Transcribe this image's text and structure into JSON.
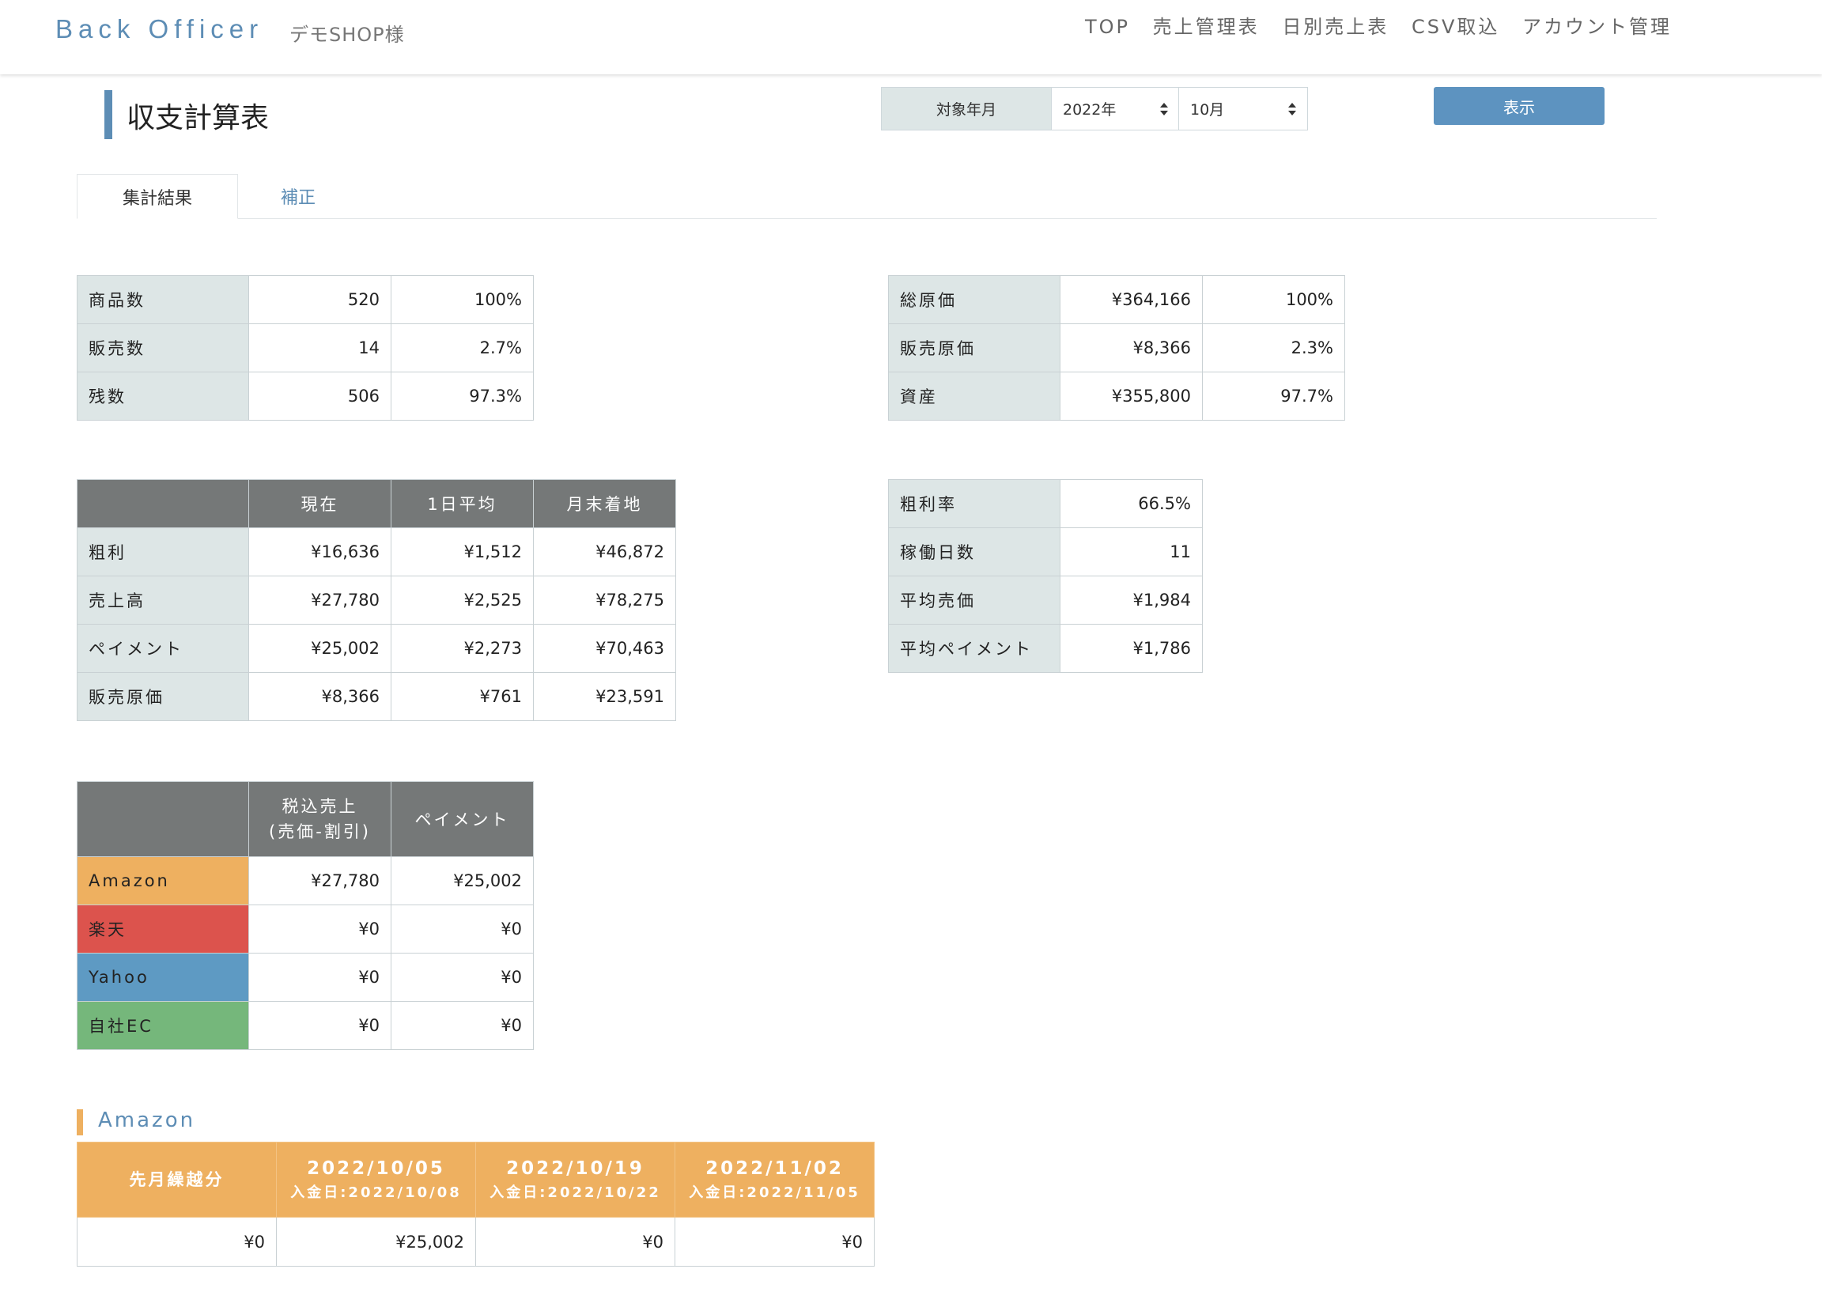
{
  "header": {
    "brand": "Back Officer",
    "shop": "デモSHOP様",
    "nav": [
      "TOP",
      "売上管理表",
      "日別売上表",
      "CSV取込",
      "アカウント管理"
    ]
  },
  "page": {
    "title": "収支計算表",
    "filter_label": "対象年月",
    "year": "2022年",
    "month": "10月",
    "show_button": "表示"
  },
  "tabs": {
    "active": "集計結果",
    "inactive": "補正"
  },
  "inventory": {
    "rows": [
      {
        "label": "商品数",
        "value": "520",
        "pct": "100%"
      },
      {
        "label": "販売数",
        "value": "14",
        "pct": "2.7%"
      },
      {
        "label": "残数",
        "value": "506",
        "pct": "97.3%"
      }
    ]
  },
  "cost": {
    "rows": [
      {
        "label": "総原価",
        "value": "¥364,166",
        "pct": "100%"
      },
      {
        "label": "販売原価",
        "value": "¥8,366",
        "pct": "2.3%"
      },
      {
        "label": "資産",
        "value": "¥355,800",
        "pct": "97.7%"
      }
    ]
  },
  "profit": {
    "headers": [
      "現在",
      "1日平均",
      "月末着地"
    ],
    "rows": [
      {
        "label": "粗利",
        "current": "¥16,636",
        "daily": "¥1,512",
        "month_end": "¥46,872"
      },
      {
        "label": "売上高",
        "current": "¥27,780",
        "daily": "¥2,525",
        "month_end": "¥78,275"
      },
      {
        "label": "ペイメント",
        "current": "¥25,002",
        "daily": "¥2,273",
        "month_end": "¥70,463"
      },
      {
        "label": "販売原価",
        "current": "¥8,366",
        "daily": "¥761",
        "month_end": "¥23,591"
      }
    ]
  },
  "stats": {
    "rows": [
      {
        "label": "粗利率",
        "value": "66.5%"
      },
      {
        "label": "稼働日数",
        "value": "11"
      },
      {
        "label": "平均売価",
        "value": "¥1,984"
      },
      {
        "label": "平均ペイメント",
        "value": "¥1,786"
      }
    ]
  },
  "channels": {
    "header_sales_line1": "税込売上",
    "header_sales_line2": "(売価-割引)",
    "header_payment": "ペイメント",
    "rows": [
      {
        "name": "Amazon",
        "sales": "¥27,780",
        "payment": "¥25,002",
        "color": "#eeb060"
      },
      {
        "name": "楽天",
        "sales": "¥0",
        "payment": "¥0",
        "color": "#dc534d"
      },
      {
        "name": "Yahoo",
        "sales": "¥0",
        "payment": "¥0",
        "color": "#5e9ac3"
      },
      {
        "name": "自社EC",
        "sales": "¥0",
        "payment": "¥0",
        "color": "#75b77b"
      }
    ]
  },
  "amazon": {
    "title": "Amazon",
    "columns": [
      {
        "date": "先月繰越分",
        "sub": ""
      },
      {
        "date": "2022/10/05",
        "sub": "入金日:2022/10/08"
      },
      {
        "date": "2022/10/19",
        "sub": "入金日:2022/10/22"
      },
      {
        "date": "2022/11/02",
        "sub": "入金日:2022/11/05"
      }
    ],
    "values": [
      "¥0",
      "¥25,002",
      "¥0",
      "¥0"
    ]
  },
  "colors": {
    "accent": "#5d8db5",
    "header_cell": "#757878",
    "label_cell": "#dde6e6"
  }
}
